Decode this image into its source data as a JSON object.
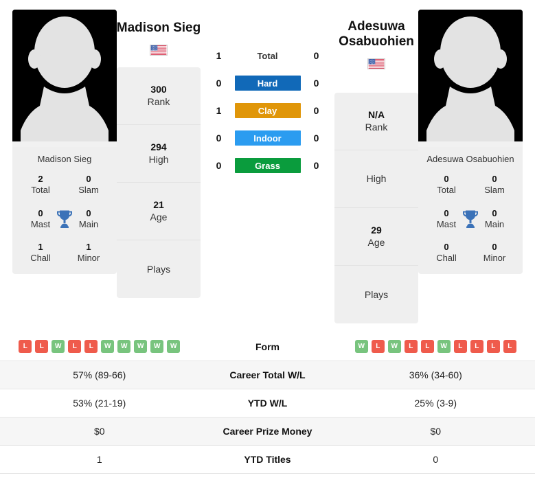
{
  "players": {
    "left": {
      "name": "Madison Sieg",
      "flag": "us-flag-icon",
      "card_name": "Madison Sieg",
      "rank": "300",
      "rank_label": "Rank",
      "high": "294",
      "high_label": "High",
      "age": "21",
      "age_label": "Age",
      "plays_value": "",
      "plays_label": "Plays",
      "titles": {
        "total": "2",
        "total_label": "Total",
        "slam": "0",
        "slam_label": "Slam",
        "mast": "0",
        "mast_label": "Mast",
        "main": "0",
        "main_label": "Main",
        "chall": "1",
        "chall_label": "Chall",
        "minor": "1",
        "minor_label": "Minor"
      },
      "form": [
        "L",
        "L",
        "W",
        "L",
        "L",
        "W",
        "W",
        "W",
        "W",
        "W"
      ],
      "career_total_wl": "57% (89-66)",
      "ytd_wl": "53% (21-19)",
      "career_prize_money": "$0",
      "ytd_titles": "1"
    },
    "right": {
      "name": "Adesuwa Osabuohien",
      "flag": "us-flag-icon",
      "card_name": "Adesuwa Osabuohien",
      "rank": "N/A",
      "rank_label": "Rank",
      "high": "",
      "high_label": "High",
      "age": "29",
      "age_label": "Age",
      "plays_value": "",
      "plays_label": "Plays",
      "titles": {
        "total": "0",
        "total_label": "Total",
        "slam": "0",
        "slam_label": "Slam",
        "mast": "0",
        "mast_label": "Mast",
        "main": "0",
        "main_label": "Main",
        "chall": "0",
        "chall_label": "Chall",
        "minor": "0",
        "minor_label": "Minor"
      },
      "form": [
        "W",
        "L",
        "W",
        "L",
        "L",
        "W",
        "L",
        "L",
        "L",
        "L"
      ],
      "career_total_wl": "36% (34-60)",
      "ytd_wl": "25% (3-9)",
      "career_prize_money": "$0",
      "ytd_titles": "0"
    }
  },
  "head_to_head": [
    {
      "label": "Total",
      "left": "1",
      "right": "0",
      "type": "plain",
      "color": ""
    },
    {
      "label": "Hard",
      "left": "0",
      "right": "0",
      "type": "surface",
      "color": "#1169b8"
    },
    {
      "label": "Clay",
      "left": "1",
      "right": "0",
      "type": "surface",
      "color": "#e09609"
    },
    {
      "label": "Indoor",
      "left": "0",
      "right": "0",
      "type": "surface",
      "color": "#2b9cf0"
    },
    {
      "label": "Grass",
      "left": "0",
      "right": "0",
      "type": "surface",
      "color": "#0a9c3d"
    }
  ],
  "table_rows": [
    {
      "label": "Form",
      "key": "form",
      "type": "form"
    },
    {
      "label": "Career Total W/L",
      "key": "career_total_wl",
      "type": "text"
    },
    {
      "label": "YTD W/L",
      "key": "ytd_wl",
      "type": "text"
    },
    {
      "label": "Career Prize Money",
      "key": "career_prize_money",
      "type": "text"
    },
    {
      "label": "YTD Titles",
      "key": "ytd_titles",
      "type": "text"
    }
  ],
  "colors": {
    "win_badge": "#78c47e",
    "loss_badge": "#ef5b4c",
    "card_bg": "#efefef",
    "row_alt_bg": "#f6f6f6"
  }
}
